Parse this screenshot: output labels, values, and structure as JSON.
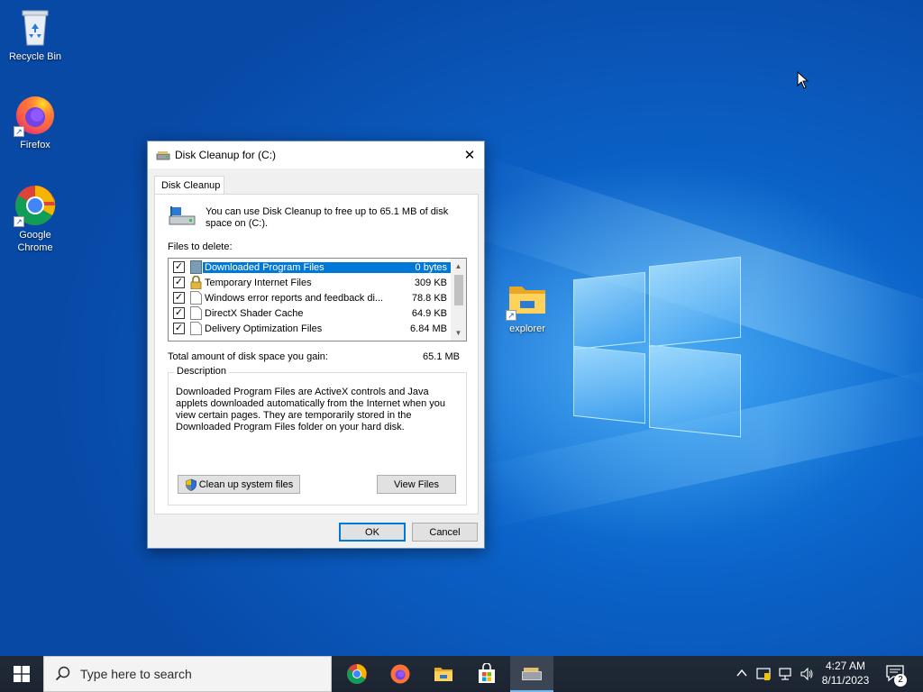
{
  "desktop": {
    "icons": [
      {
        "label": "Recycle Bin",
        "icon": "recycle-bin-icon"
      },
      {
        "label": "Firefox",
        "icon": "firefox-icon"
      },
      {
        "label": "Google Chrome",
        "icon": "chrome-icon"
      },
      {
        "label": "explorer",
        "icon": "folder-icon"
      }
    ]
  },
  "dialog": {
    "title": "Disk Cleanup for  (C:)",
    "tab": "Disk Cleanup",
    "intro": "You can use Disk Cleanup to free up to 65.1 MB of disk space on  (C:).",
    "files_label": "Files to delete:",
    "files": [
      {
        "checked": true,
        "name": "Downloaded Program Files",
        "size": "0 bytes",
        "selected": true
      },
      {
        "checked": true,
        "name": "Temporary Internet Files",
        "size": "309 KB",
        "selected": false
      },
      {
        "checked": true,
        "name": "Windows error reports and feedback di...",
        "size": "78.8 KB",
        "selected": false
      },
      {
        "checked": true,
        "name": "DirectX Shader Cache",
        "size": "64.9 KB",
        "selected": false
      },
      {
        "checked": true,
        "name": "Delivery Optimization Files",
        "size": "6.84 MB",
        "selected": false
      }
    ],
    "total_label": "Total amount of disk space you gain:",
    "total_value": "65.1 MB",
    "description_legend": "Description",
    "description_text": "Downloaded Program Files are ActiveX controls and Java applets downloaded automatically from the Internet when you view certain pages. They are temporarily stored in the Downloaded Program Files folder on your hard disk.",
    "cleanup_button": "Clean up system files",
    "view_files_button": "View Files",
    "ok_button": "OK",
    "cancel_button": "Cancel",
    "close_glyph": "✕"
  },
  "taskbar": {
    "search_placeholder": "Type here to search",
    "apps": [
      "chrome-icon",
      "firefox-icon",
      "file-explorer-icon",
      "store-icon",
      "disk-cleanup-icon"
    ],
    "time": "4:27 AM",
    "date": "8/11/2023",
    "notification_count": "2"
  },
  "colors": {
    "accent": "#0078d7",
    "taskbar": "#1e2733",
    "desktop": "#0b62c8"
  }
}
